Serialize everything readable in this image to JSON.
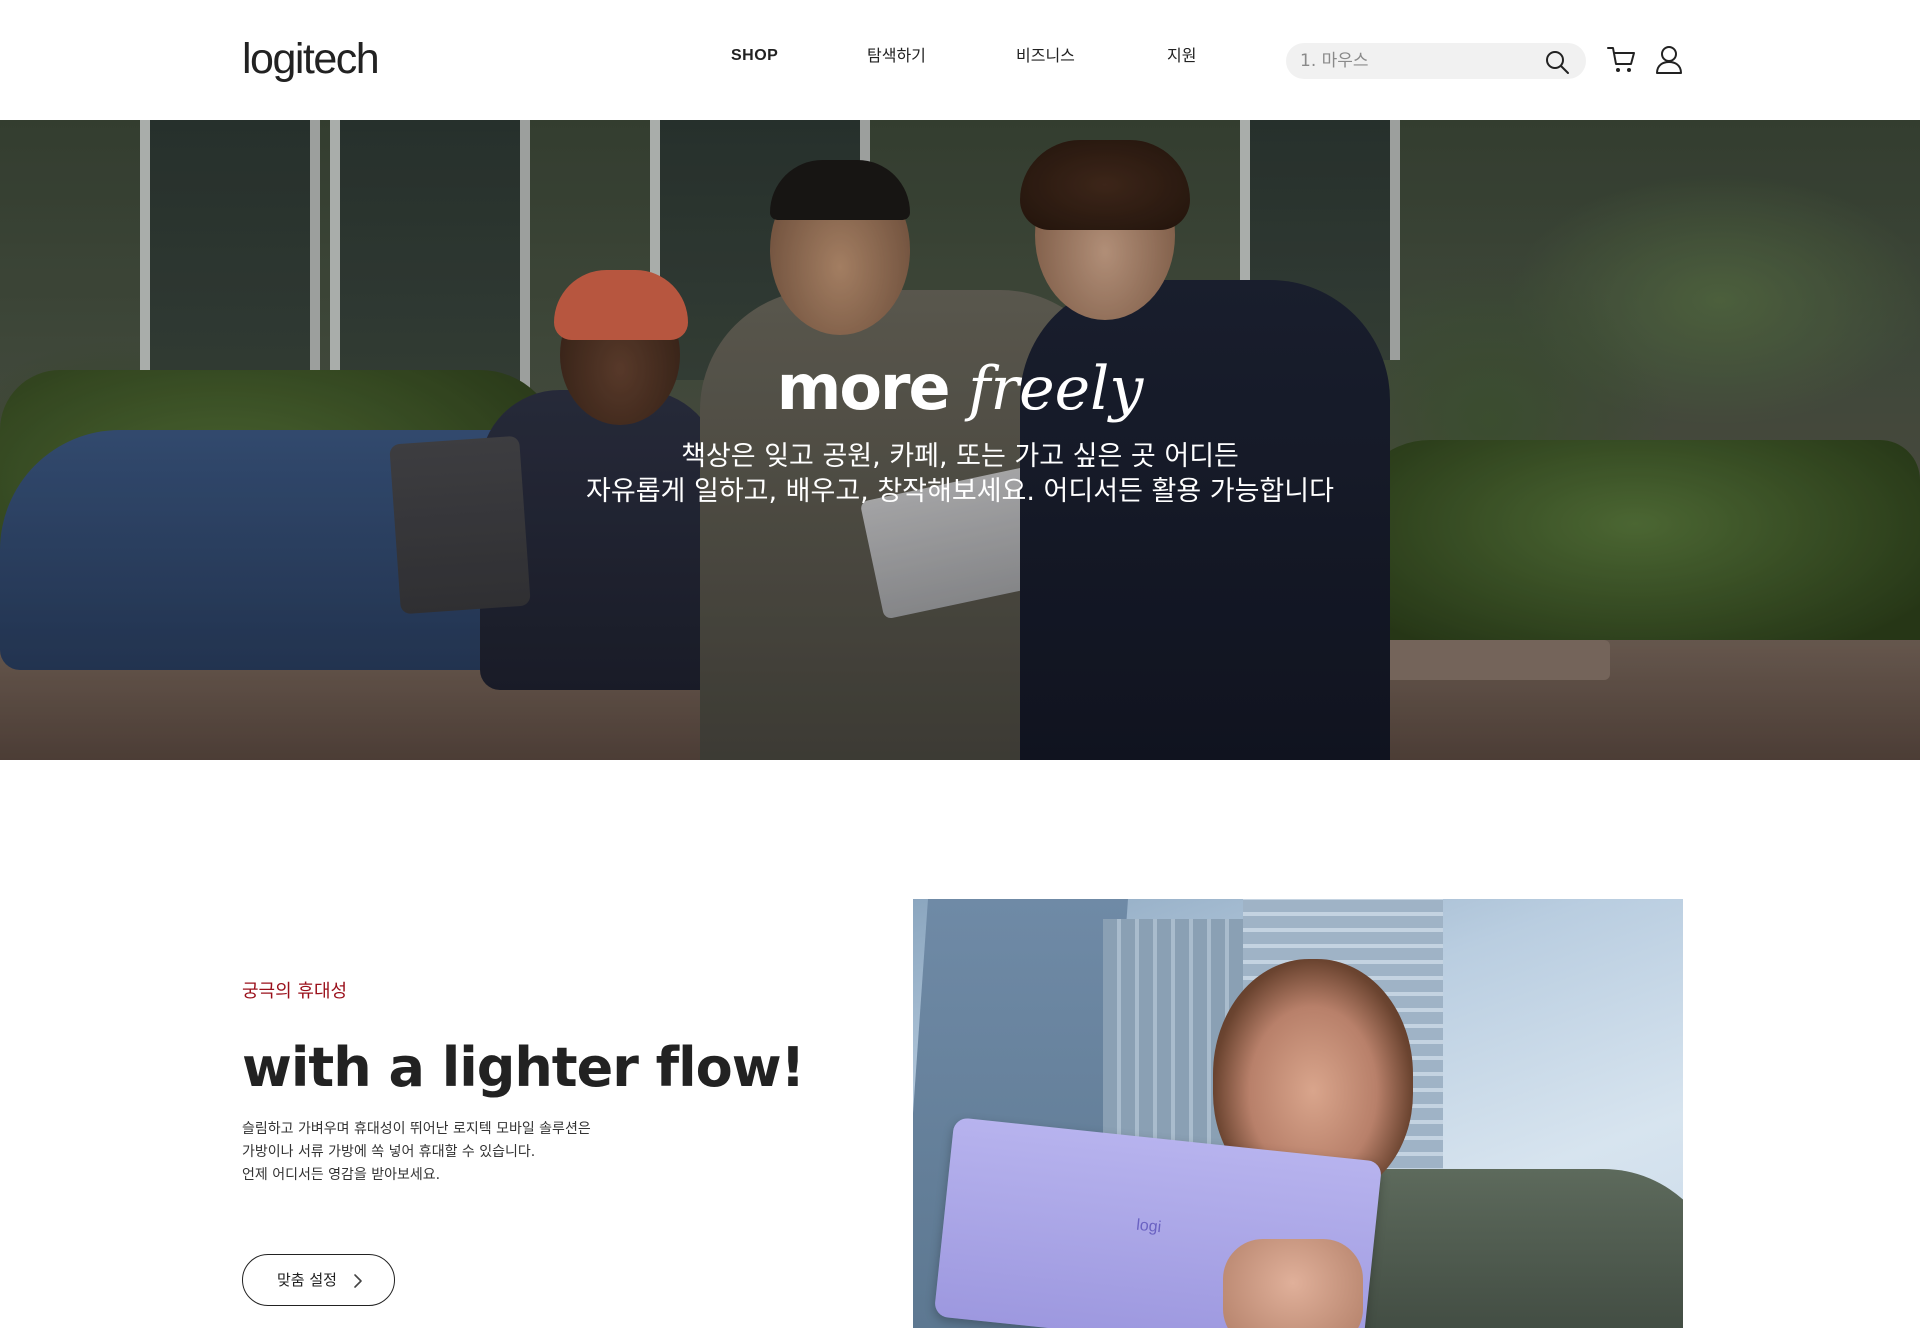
{
  "header": {
    "logo": "logitech",
    "nav": {
      "shop": "SHOP",
      "explore": "탐색하기",
      "business": "비즈니스",
      "support": "지원"
    },
    "search": {
      "placeholder": "1. 마우스"
    },
    "icons": [
      "search-icon",
      "cart-icon",
      "account-icon"
    ]
  },
  "hero": {
    "title_bold": "more",
    "title_script": "freely",
    "subtitle_line1": "책상은 잊고 공원, 카페, 또는 가고 싶은 곳 어디든",
    "subtitle_line2": "자유롭게 일하고, 배우고, 창작해보세요. 어디서든 활용 가능합니다"
  },
  "feature": {
    "eyebrow": "궁극의 휴대성",
    "title": "with a lighter flow!",
    "description_line1": "슬림하고 가벼우며 휴대성이 뛰어난 로지텍 모바일 솔루션은",
    "description_line2": "가방이나 서류 가방에 쏙 넣어 휴대할 수 있습니다.",
    "description_line3": "언제 어디서든 영감을 받아보세요.",
    "cta_label": "맞춤 설정",
    "image_tablet_logo": "logi"
  },
  "colors": {
    "eyebrow": "#9a0f1a",
    "text": "#222222",
    "search_bg": "#f1f1f1"
  }
}
